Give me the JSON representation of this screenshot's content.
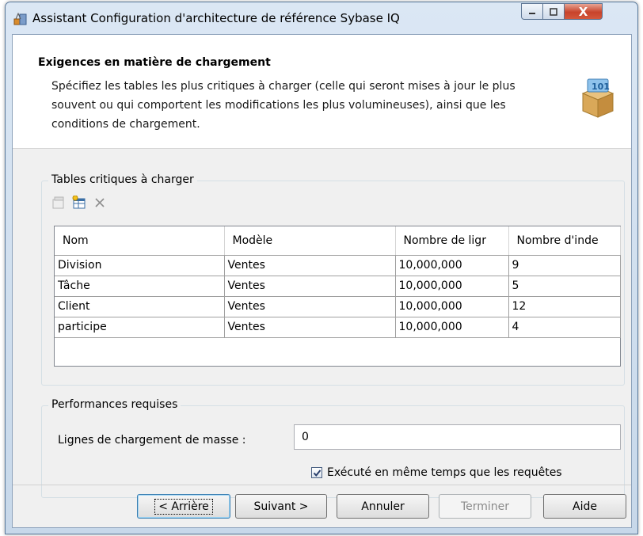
{
  "window": {
    "title": "Assistant Configuration d'architecture de référence Sybase IQ",
    "close_glyph": "X"
  },
  "header": {
    "title": "Exigences en matière de chargement",
    "description": "Spécifiez les tables les plus critiques à charger (celle qui seront mises à jour le plus souvent ou qui comportent les modifications les plus volumineuses), ainsi que les conditions de chargement."
  },
  "critical_tables": {
    "group_label": "Tables critiques à charger",
    "toolbar": [
      "properties-icon",
      "add-rows-icon",
      "delete-icon"
    ],
    "columns": [
      "Nom",
      "Modèle",
      "Nombre de ligr",
      "Nombre d'inde"
    ],
    "rows": [
      [
        "Division",
        "Ventes",
        "10,000,000",
        "9"
      ],
      [
        "Tâche",
        "Ventes",
        "10,000,000",
        "5"
      ],
      [
        "Client",
        "Ventes",
        "10,000,000",
        "12"
      ],
      [
        "participe",
        "Ventes",
        "10,000,000",
        "4"
      ]
    ]
  },
  "performance": {
    "group_label": "Performances requises",
    "bulk_lines_label": "Lignes de chargement de masse :",
    "bulk_lines_value": "0",
    "concurrent_label": "Exécuté en même temps que les requêtes",
    "concurrent_checked": true
  },
  "buttons": {
    "back": "< Arrière",
    "next": "Suivant >",
    "cancel": "Annuler",
    "finish": "Terminer",
    "help": "Aide"
  }
}
